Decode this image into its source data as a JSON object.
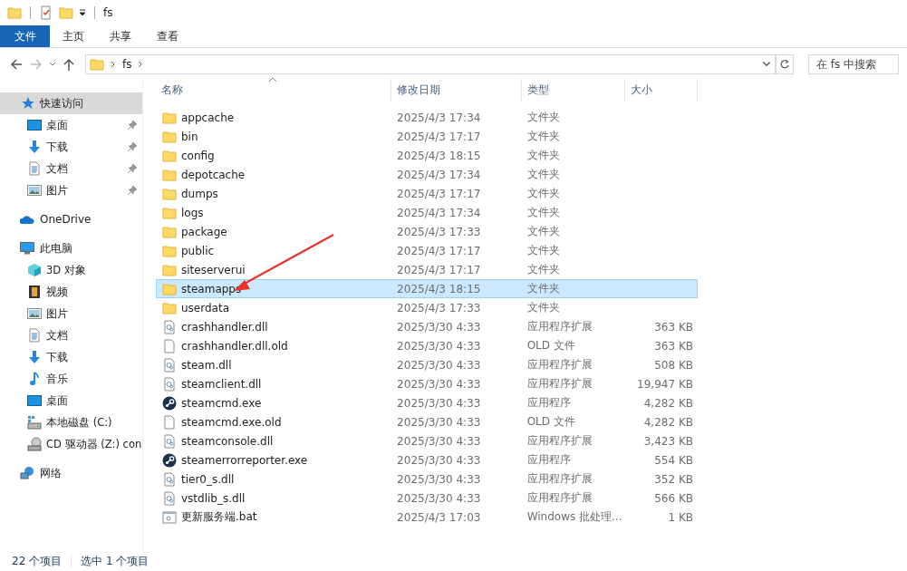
{
  "window": {
    "title": "fs"
  },
  "ribbon_tabs": [
    {
      "label": "文件",
      "selected": true
    },
    {
      "label": "主页",
      "selected": false
    },
    {
      "label": "共享",
      "selected": false
    },
    {
      "label": "查看",
      "selected": false
    }
  ],
  "navigation": {
    "back_disabled": false,
    "forward_disabled": true
  },
  "address_bar": {
    "path": [
      "fs"
    ]
  },
  "search": {
    "placeholder": "在 fs 中搜索"
  },
  "sidebar": {
    "groups": [
      {
        "label": "快速访问",
        "kind": "star",
        "selected": true,
        "children": [
          {
            "label": "桌面",
            "kind": "desktop",
            "pinned": true
          },
          {
            "label": "下载",
            "kind": "download",
            "pinned": true
          },
          {
            "label": "文档",
            "kind": "document",
            "pinned": true
          },
          {
            "label": "图片",
            "kind": "picture",
            "pinned": true
          }
        ]
      },
      {
        "label": "OneDrive",
        "kind": "cloud",
        "selected": false
      },
      {
        "label": "此电脑",
        "kind": "pc",
        "selected": false,
        "children": [
          {
            "label": "3D 对象",
            "kind": "cube",
            "pinned": false
          },
          {
            "label": "视频",
            "kind": "video",
            "pinned": false
          },
          {
            "label": "图片",
            "kind": "picture",
            "pinned": false
          },
          {
            "label": "文档",
            "kind": "document",
            "pinned": false
          },
          {
            "label": "下载",
            "kind": "download",
            "pinned": false
          },
          {
            "label": "音乐",
            "kind": "music",
            "pinned": false
          },
          {
            "label": "桌面",
            "kind": "desktop",
            "pinned": false
          },
          {
            "label": "本地磁盘 (C:)",
            "kind": "drive",
            "pinned": false
          },
          {
            "label": "CD 驱动器 (Z:) con",
            "kind": "cd",
            "pinned": false
          }
        ]
      },
      {
        "label": "网络",
        "kind": "network",
        "selected": false
      }
    ]
  },
  "table": {
    "columns": [
      "名称",
      "修改日期",
      "类型",
      "大小"
    ],
    "rows": [
      {
        "kind": "folder",
        "name": "appcache",
        "modified": "2025/4/3 17:34",
        "type": "文件夹",
        "selected": false
      },
      {
        "kind": "folder",
        "name": "bin",
        "modified": "2025/4/3 17:17",
        "type": "文件夹",
        "selected": false
      },
      {
        "kind": "folder",
        "name": "config",
        "modified": "2025/4/3 18:15",
        "type": "文件夹",
        "selected": false
      },
      {
        "kind": "folder",
        "name": "depotcache",
        "modified": "2025/4/3 17:34",
        "type": "文件夹",
        "selected": false
      },
      {
        "kind": "folder",
        "name": "dumps",
        "modified": "2025/4/3 17:17",
        "type": "文件夹",
        "selected": false
      },
      {
        "kind": "folder",
        "name": "logs",
        "modified": "2025/4/3 17:34",
        "type": "文件夹",
        "selected": false
      },
      {
        "kind": "folder",
        "name": "package",
        "modified": "2025/4/3 17:33",
        "type": "文件夹",
        "selected": false
      },
      {
        "kind": "folder",
        "name": "public",
        "modified": "2025/4/3 17:17",
        "type": "文件夹",
        "selected": false
      },
      {
        "kind": "folder",
        "name": "siteserverui",
        "modified": "2025/4/3 17:17",
        "type": "文件夹",
        "selected": false
      },
      {
        "kind": "folder",
        "name": "steamapps",
        "modified": "2025/4/3 18:15",
        "type": "文件夹",
        "selected": true
      },
      {
        "kind": "folder",
        "name": "userdata",
        "modified": "2025/4/3 17:33",
        "type": "文件夹",
        "selected": false
      },
      {
        "kind": "dll",
        "name": "crashhandler.dll",
        "modified": "2025/3/30 4:33",
        "type": "应用程序扩展",
        "size": "363 KB",
        "selected": false
      },
      {
        "kind": "file",
        "name": "crashhandler.dll.old",
        "modified": "2025/3/30 4:33",
        "type": "OLD 文件",
        "size": "363 KB",
        "selected": false
      },
      {
        "kind": "dll",
        "name": "steam.dll",
        "modified": "2025/3/30 4:33",
        "type": "应用程序扩展",
        "size": "508 KB",
        "selected": false
      },
      {
        "kind": "dll",
        "name": "steamclient.dll",
        "modified": "2025/3/30 4:33",
        "type": "应用程序扩展",
        "size": "19,947 KB",
        "selected": false
      },
      {
        "kind": "exe",
        "name": "steamcmd.exe",
        "modified": "2025/3/30 4:33",
        "type": "应用程序",
        "size": "4,282 KB",
        "selected": false
      },
      {
        "kind": "file",
        "name": "steamcmd.exe.old",
        "modified": "2025/3/30 4:33",
        "type": "OLD 文件",
        "size": "4,282 KB",
        "selected": false
      },
      {
        "kind": "dll",
        "name": "steamconsole.dll",
        "modified": "2025/3/30 4:33",
        "type": "应用程序扩展",
        "size": "3,423 KB",
        "selected": false
      },
      {
        "kind": "exe",
        "name": "steamerrorreporter.exe",
        "modified": "2025/3/30 4:33",
        "type": "应用程序",
        "size": "554 KB",
        "selected": false
      },
      {
        "kind": "dll",
        "name": "tier0_s.dll",
        "modified": "2025/3/30 4:33",
        "type": "应用程序扩展",
        "size": "352 KB",
        "selected": false
      },
      {
        "kind": "dll",
        "name": "vstdlib_s.dll",
        "modified": "2025/3/30 4:33",
        "type": "应用程序扩展",
        "size": "566 KB",
        "selected": false
      },
      {
        "kind": "bat",
        "name": "更新服务端.bat",
        "modified": "2025/4/3 17:03",
        "type": "Windows 批处理...",
        "size": "1 KB",
        "selected": false
      }
    ]
  },
  "status_bar": {
    "count": "22 个项目",
    "selection": "选中 1 个项目"
  }
}
